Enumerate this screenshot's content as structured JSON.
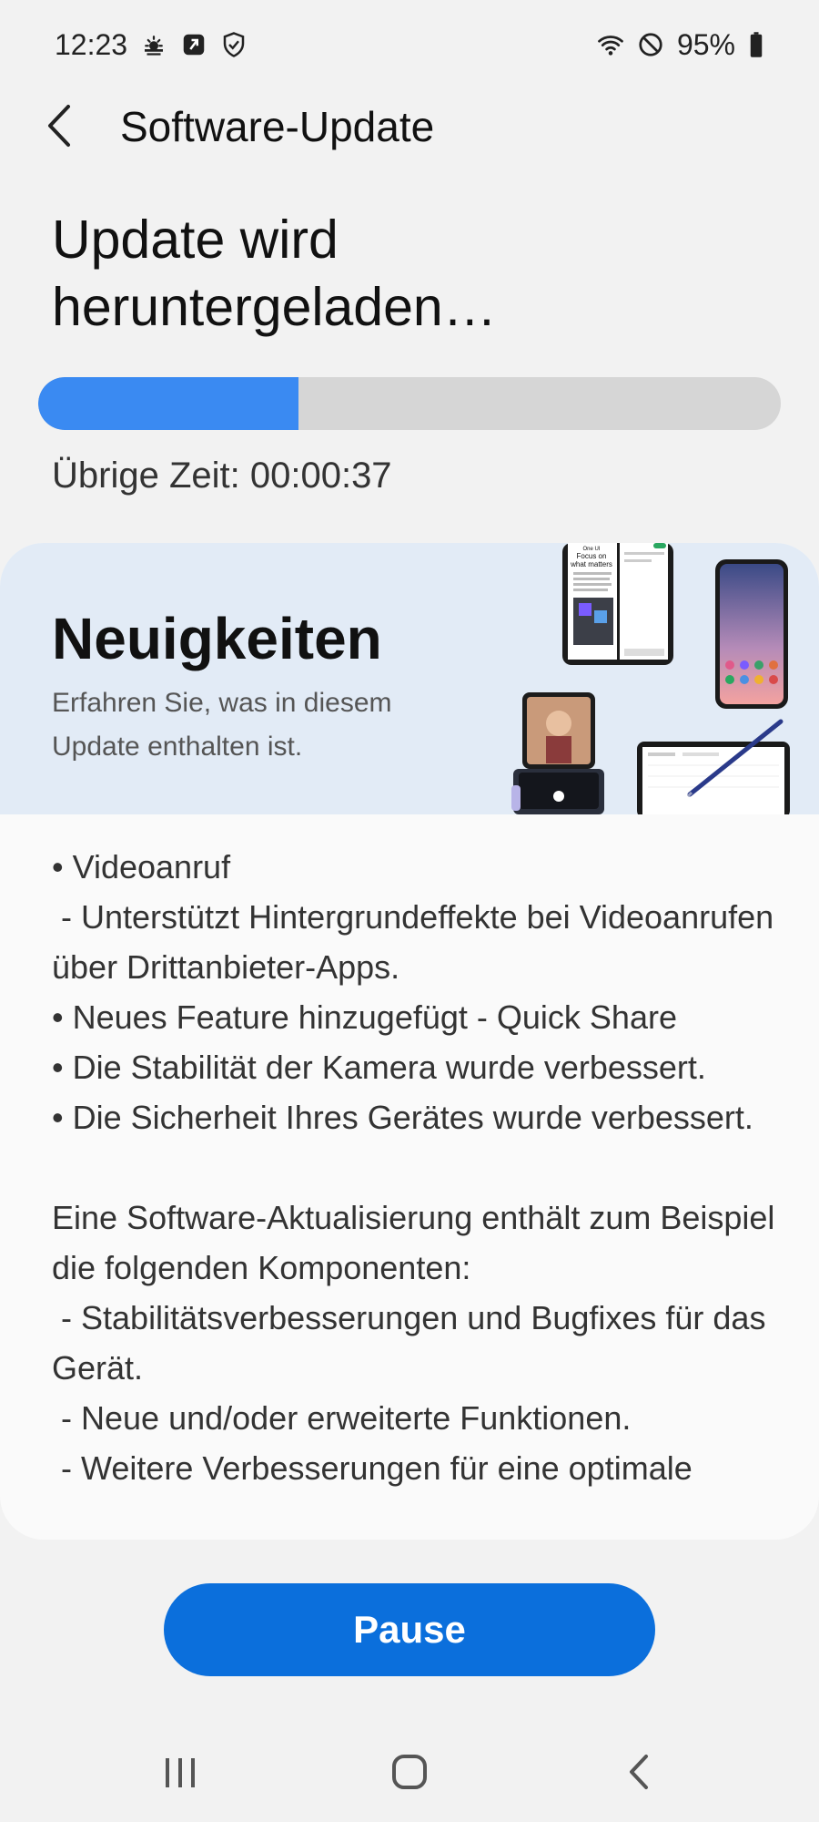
{
  "status_bar": {
    "time": "12:23",
    "left_icons": [
      "weather-icon",
      "nfc-app-icon",
      "shield-check-icon"
    ],
    "right_icons": [
      "wifi-icon",
      "dnd-icon",
      "battery-icon"
    ],
    "battery_text": "95%"
  },
  "header": {
    "title": "Software-Update"
  },
  "update": {
    "status": "Update wird heruntergeladen…",
    "progress_fraction": 0.35,
    "remaining_label": "Übrige Zeit: 00:00:37",
    "progress_color": "#3a8af2"
  },
  "news": {
    "title": "Neuigkeiten",
    "subtitle": "Erfahren Sie, was in diesem Update enthalten ist.",
    "device_screen_text": [
      "One UI",
      "Focus on",
      "what matters"
    ],
    "notes": [
      "• Videoanruf",
      " - Unterstützt Hintergrundeffekte bei Videoanrufen über Drittanbieter-Apps.",
      "• Neues Feature hinzugefügt - Quick Share",
      "• Die Stabilität der Kamera wurde verbessert.",
      "• Die Sicherheit Ihres Gerätes wurde verbessert.",
      "",
      "Eine Software-Aktualisierung enthält zum Beispiel die folgenden Komponenten:",
      " - Stabilitätsverbesserungen und Bugfixes für das Gerät.",
      " - Neue und/oder erweiterte Funktionen.",
      " - Weitere Verbesserungen für eine optimale"
    ]
  },
  "actions": {
    "pause_label": "Pause",
    "button_color": "#0b6fdc"
  },
  "navigation": {
    "buttons": [
      "recents-icon",
      "home-icon",
      "back-icon"
    ]
  }
}
